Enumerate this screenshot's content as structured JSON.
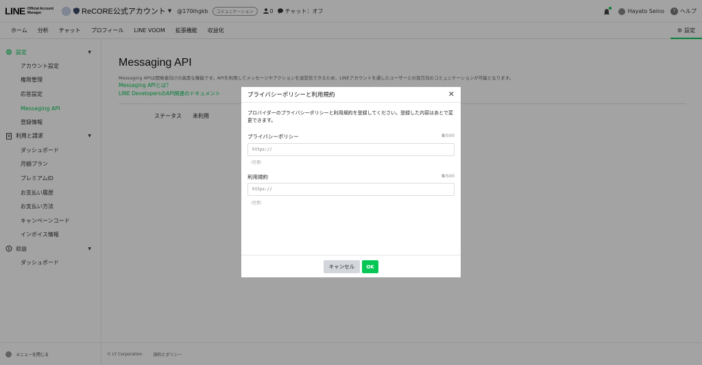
{
  "header": {
    "logo_main": "LINE",
    "logo_sub1": "Official Account",
    "logo_sub2": "Manager",
    "account_name": "ReCORE公式アカウント",
    "account_id": "@170ihgkb",
    "account_badge": "コミュニケーション",
    "friends_count": "0",
    "chat_status": "チャット：オフ",
    "user_name": "Hayato Seino",
    "help_label": "ヘルプ"
  },
  "nav": {
    "items": [
      "ホーム",
      "分析",
      "チャット",
      "プロフィール",
      "LINE VOOM",
      "拡張機能",
      "収益化"
    ],
    "settings_label": "設定"
  },
  "sidebar": {
    "group_settings": "設定",
    "settings_items": [
      "アカウント設定",
      "権限管理",
      "応答設定",
      "Messaging API",
      "登録情報"
    ],
    "group_billing": "利用と請求",
    "billing_items": [
      "ダッシュボード",
      "月額プラン",
      "プレミアムID",
      "お支払い履歴",
      "お支払い方法",
      "キャンペーンコード",
      "インボイス情報"
    ],
    "group_revenue": "収益",
    "revenue_items": [
      "ダッシュボード"
    ],
    "close_menu": "メニューを閉じる"
  },
  "main": {
    "title": "Messaging API",
    "description": "Messaging APIは開発者向けの高度な機能です。APIを利用してメッセージやアクションを送受信できるため、LINEアカウントを通したユーザーとの双方向のコミュニケーションが可能となります。",
    "link_what": "Messaging APIとは？",
    "link_docs": "LINE DevelopersのAPI関連のドキュメント",
    "status_label": "ステータス",
    "status_value": "未利用",
    "footer_copyright": "© LY Corporation",
    "footer_policy": "規約とポリシー"
  },
  "modal": {
    "title": "プライバシーポリシーと利用規約",
    "description": "プロバイダーのプライバシーポリシーと利用規約を登録してください。登録した内容はあとで変更できます。",
    "privacy_label": "プライバシーポリシー",
    "privacy_count": "0",
    "privacy_max": "/500",
    "privacy_placeholder": "https://",
    "privacy_note": "（任意）",
    "terms_label": "利用規約",
    "terms_count": "0",
    "terms_max": "/500",
    "terms_placeholder": "https://",
    "terms_note": "（任意）",
    "cancel_label": "キャンセル",
    "ok_label": "OK"
  },
  "colors": {
    "accent": "#06c755",
    "overlay": "rgba(0,0,0,0.36)",
    "cancel_bg": "#d3d6db"
  }
}
